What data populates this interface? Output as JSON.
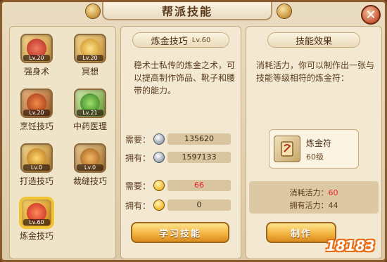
{
  "window": {
    "title": "帮派技能"
  },
  "skills": [
    {
      "name": "强身术",
      "level": "Lv.20",
      "color": "#d8433a"
    },
    {
      "name": "冥想",
      "level": "Lv.20",
      "color": "#e2a52e"
    },
    {
      "name": "烹饪技巧",
      "level": "Lv.20",
      "color": "#c9591c"
    },
    {
      "name": "中药医理",
      "level": "Lv.21",
      "color": "#4fa83a"
    },
    {
      "name": "打造技巧",
      "level": "Lv.0",
      "color": "#e2a52e"
    },
    {
      "name": "裁缝技巧",
      "level": "Lv.0",
      "color": "#c87b2a"
    },
    {
      "name": "炼金技巧",
      "level": "Lv.60",
      "color": "#e0412a"
    }
  ],
  "detail": {
    "name": "炼金技巧",
    "level": "Lv.60",
    "description": "稳术士私传的炼金之术，可以提高制作饰品、靴子和腰带的能力。",
    "silver_need_label": "需要：",
    "silver_need": "135620",
    "silver_have_label": "拥有：",
    "silver_have": "1597133",
    "contrib_need_label": "需要：",
    "contrib_need": "66",
    "contrib_have_label": "拥有：",
    "contrib_have": "0",
    "learn_button": "学习技能"
  },
  "effect": {
    "heading": "技能效果",
    "description": "消耗活力，你可以制作出一张与技能等级相符的炼金符：",
    "item_name": "炼金符",
    "item_level": "60级",
    "cost_label": "消耗活力：",
    "cost_value": "60",
    "have_label": "拥有活力：",
    "have_value": "44",
    "make_button": "制作"
  },
  "watermark": "18183"
}
